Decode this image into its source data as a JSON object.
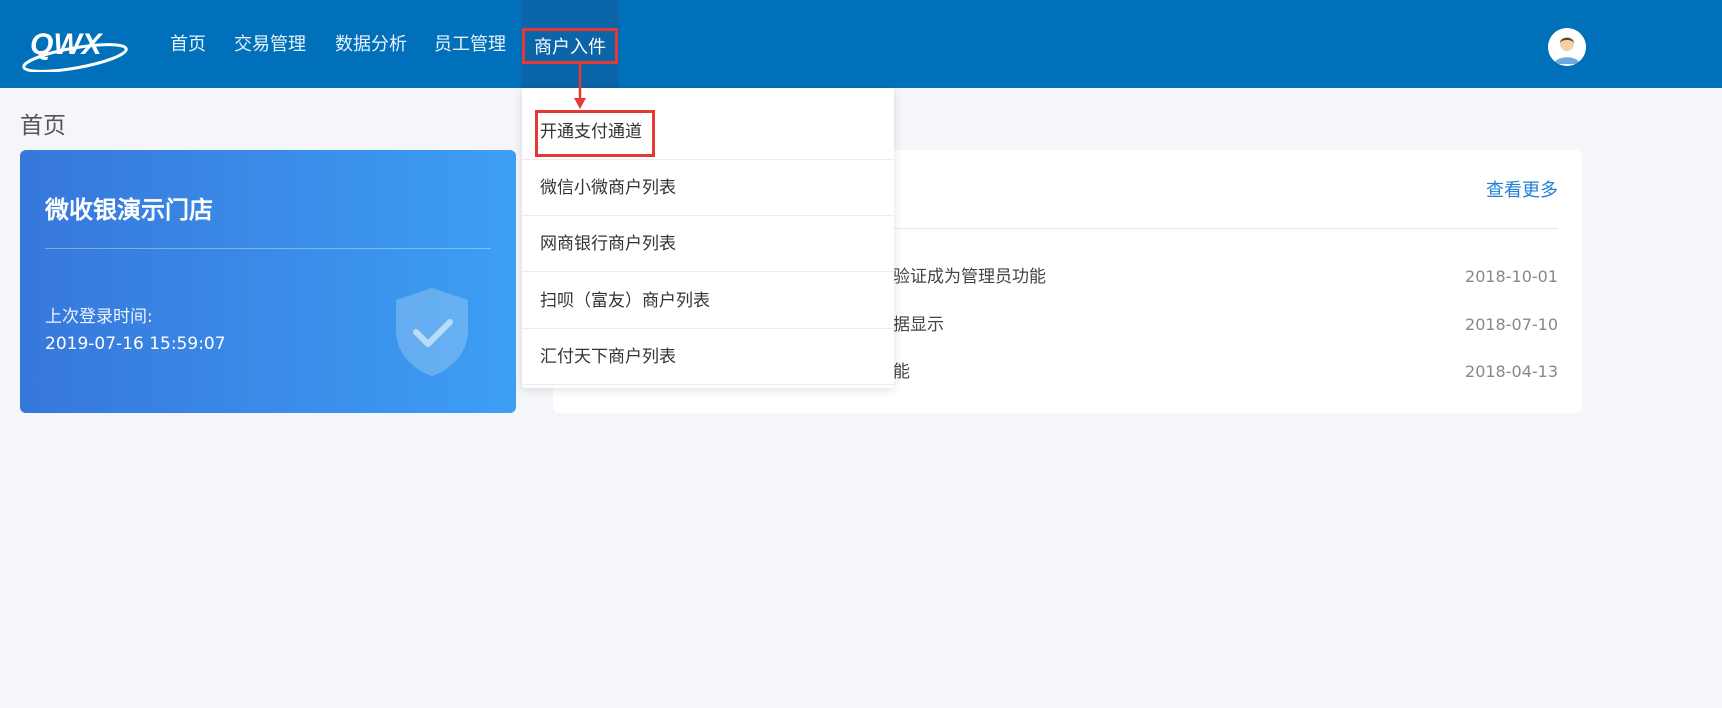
{
  "header": {
    "logo_text": "QWX",
    "nav": [
      {
        "label": "首页"
      },
      {
        "label": "交易管理"
      },
      {
        "label": "数据分析"
      },
      {
        "label": "员工管理"
      },
      {
        "label": "商户入件"
      }
    ]
  },
  "page": {
    "title": "首页"
  },
  "store_card": {
    "name": "微收银演示门店",
    "last_login_label": "上次登录时间:",
    "last_login_time": "2019-07-16 15:59:07"
  },
  "notices": {
    "more_label": "查看更多",
    "items": [
      {
        "title": "验证成为管理员功能",
        "date": "2018-10-01"
      },
      {
        "title": "据显示",
        "date": "2018-07-10"
      },
      {
        "title": "能",
        "date": "2018-04-13"
      }
    ]
  },
  "dropdown": {
    "items": [
      {
        "label": "开通支付通道"
      },
      {
        "label": "微信小微商户列表"
      },
      {
        "label": "网商银行商户列表"
      },
      {
        "label": "扫呗（富友）商户列表"
      },
      {
        "label": "汇付天下商户列表"
      }
    ]
  },
  "colors": {
    "header_bg": "#0070bb",
    "highlight": "#e53935",
    "link": "#1f7fd4"
  }
}
